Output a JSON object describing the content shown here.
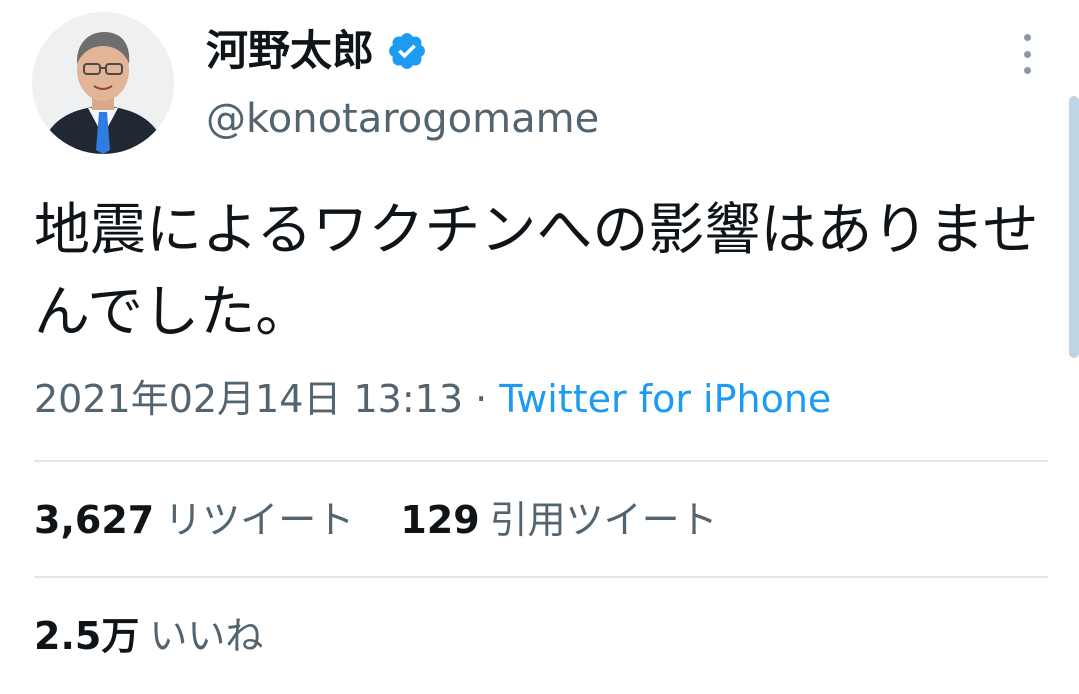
{
  "user": {
    "display_name": "河野太郎",
    "handle": "@konotarogomame",
    "verified": true,
    "avatar_icon": "profile-photo"
  },
  "tweet": {
    "text": "地震によるワクチンへの影響はありませんでした。",
    "timestamp": "2021年02月14日 13:13",
    "separator": " · ",
    "source": "Twitter for iPhone"
  },
  "stats": {
    "retweets": {
      "count": "3,627",
      "label": "リツイート"
    },
    "quotes": {
      "count": "129",
      "label": "引用ツイート"
    },
    "likes": {
      "count": "2.5万",
      "label": "いいね"
    }
  },
  "colors": {
    "accent": "#1d9bf0",
    "secondary_text": "#536471",
    "primary_text": "#0f1419"
  }
}
